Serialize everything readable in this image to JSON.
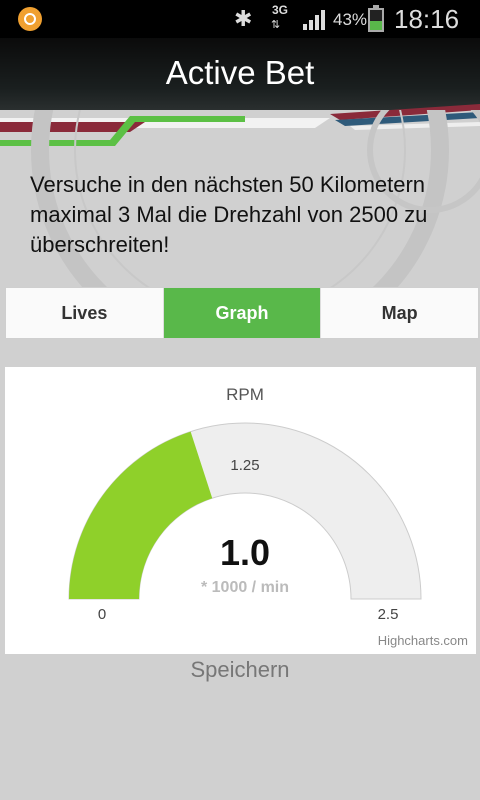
{
  "status_bar": {
    "network": "3G",
    "network_arrows": "⇅",
    "battery_pct": "43%",
    "battery_level": 0.43,
    "time": "18:16",
    "bluetooth_icon": "bluetooth-icon",
    "app_icon": "app-notification-icon"
  },
  "header": {
    "title": "Active Bet"
  },
  "bet": {
    "description": "Versuche in den nächsten 50 Kilometern maximal 3 Mal die Drehzahl von 2500 zu überschreiten!"
  },
  "tabs": [
    {
      "label": "Lives",
      "active": false
    },
    {
      "label": "Graph",
      "active": true
    },
    {
      "label": "Map",
      "active": false
    }
  ],
  "chart_data": {
    "type": "gauge",
    "title": "RPM",
    "value": 1.0,
    "value_label": "1.0",
    "unit": "* 1000 / min",
    "min": 0,
    "max": 2.5,
    "ticks": [
      {
        "value": 0,
        "label": "0"
      },
      {
        "value": 1.25,
        "label": "1.25"
      },
      {
        "value": 2.5,
        "label": "2.5"
      }
    ],
    "fill_color": "#8fd02a",
    "track_color": "#eeeeee"
  },
  "credits": "Highcharts.com",
  "actions": {
    "save_label": "Speichern"
  }
}
